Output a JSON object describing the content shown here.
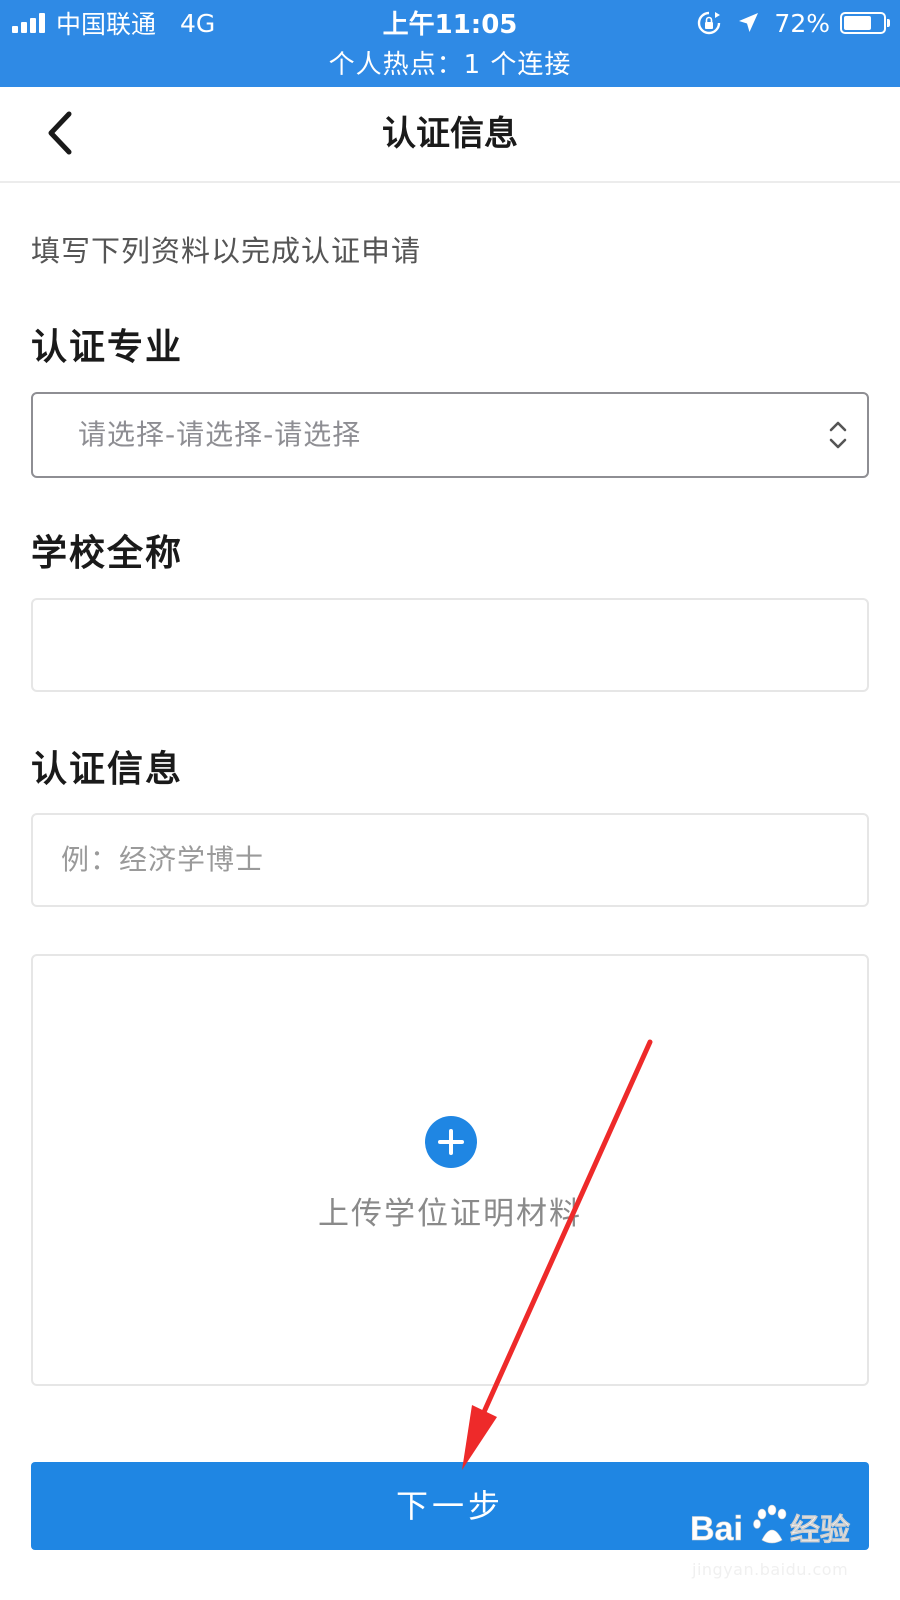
{
  "status_bar": {
    "carrier": "中国联通",
    "network": "4G",
    "time": "上午11:05",
    "battery": "72%",
    "battery_level": 0.72,
    "hotspot": "个人热点：1 个连接"
  },
  "nav": {
    "title": "认证信息",
    "back_icon": "chevron-left-icon"
  },
  "form": {
    "intro": "填写下列资料以完成认证申请",
    "major": {
      "label": "认证专业",
      "placeholder": "请选择-请选择-请选择"
    },
    "school": {
      "label": "学校全称",
      "value": ""
    },
    "cert": {
      "label": "认证信息",
      "placeholder": "例：经济学博士"
    },
    "upload": {
      "label": "上传学位证明材料",
      "icon": "plus-circle-icon"
    }
  },
  "next_button": {
    "label": "下一步"
  },
  "watermark": {
    "brand": "Baidu经验",
    "url": "jingyan.baidu.com"
  },
  "colors": {
    "status_bar": "#2f8ae5",
    "primary": "#1f86e3",
    "annotation_arrow": "#ee2a2a"
  }
}
